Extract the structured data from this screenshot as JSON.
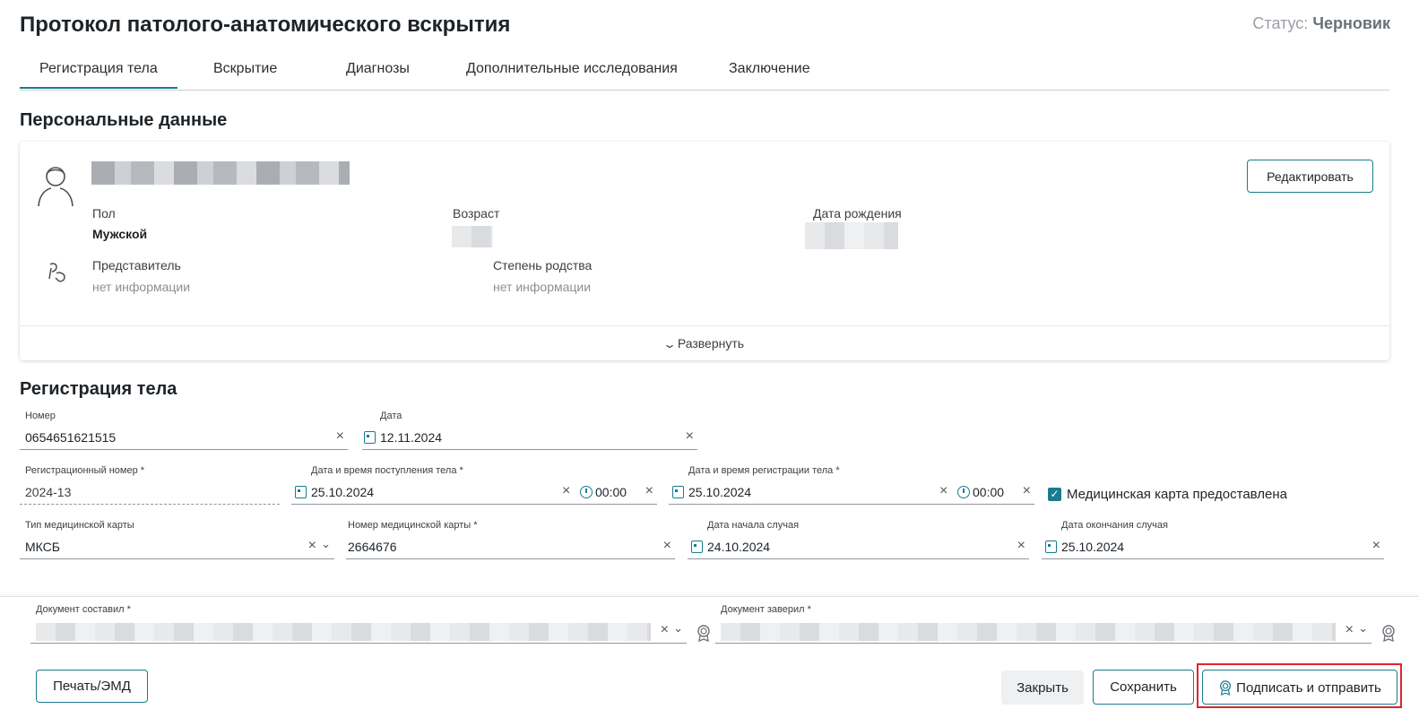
{
  "header": {
    "title": "Протокол патолого-анатомического вскрытия",
    "status_label": "Статус:",
    "status_value": "Черновик"
  },
  "tabs": [
    {
      "label": "Регистрация тела",
      "active": true
    },
    {
      "label": "Вскрытие",
      "active": false
    },
    {
      "label": "Диагнозы",
      "active": false
    },
    {
      "label": "Дополнительные исследования",
      "active": false
    },
    {
      "label": "Заключение",
      "active": false
    }
  ],
  "personal": {
    "section_title": "Персональные данные",
    "edit_button": "Редактировать",
    "sex_label": "Пол",
    "sex_value": "Мужской",
    "age_label": "Возраст",
    "birth_label": "Дата рождения",
    "representative_label": "Представитель",
    "representative_value": "нет информации",
    "kinship_label": "Степень родства",
    "kinship_value": "нет информации",
    "expand_label": "Развернуть"
  },
  "registration": {
    "section_title": "Регистрация тела",
    "number": {
      "label": "Номер",
      "value": "0654651621515"
    },
    "date": {
      "label": "Дата",
      "value": "12.11.2024"
    },
    "reg_number": {
      "label": "Регистрационный номер *",
      "value": "2024-13"
    },
    "arrival": {
      "label": "Дата и время поступления тела *",
      "date": "25.10.2024",
      "time": "00:00"
    },
    "registered": {
      "label": "Дата и время регистрации тела *",
      "date": "25.10.2024",
      "time": "00:00"
    },
    "med_card_provided": {
      "label": "Медицинская карта предоставлена",
      "checked": true
    },
    "card_type": {
      "label": "Тип медицинской карты",
      "value": "МКСБ"
    },
    "card_number": {
      "label": "Номер медицинской карты *",
      "value": "2664676"
    },
    "case_start": {
      "label": "Дата начала случая",
      "value": "24.10.2024"
    },
    "case_end": {
      "label": "Дата окончания случая",
      "value": "25.10.2024"
    }
  },
  "footer": {
    "composed_label": "Документ составил *",
    "certified_label": "Документ заверил *",
    "print_button": "Печать/ЭМД",
    "close_button": "Закрыть",
    "save_button": "Сохранить",
    "sign_button": "Подписать и отправить"
  },
  "colors": {
    "accent": "#1a7c8e",
    "highlight_frame": "#e0232b"
  },
  "icons": [
    "user-icon",
    "representative-icon",
    "chevron-down-icon",
    "calendar-icon",
    "clock-icon",
    "clear-icon",
    "certificate-icon",
    "checkbox-checked-icon"
  ]
}
